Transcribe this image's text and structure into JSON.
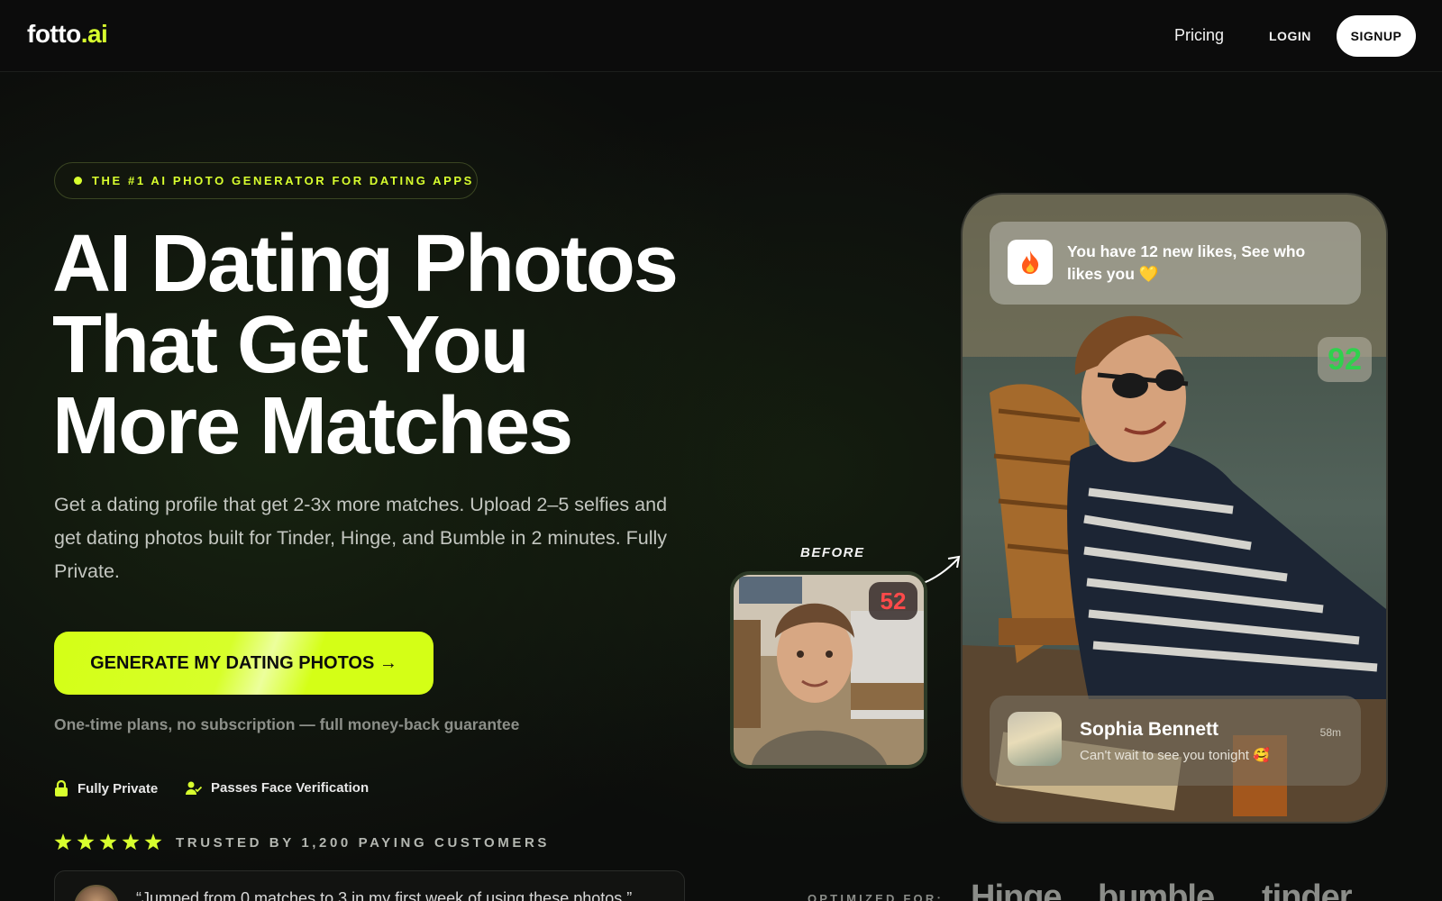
{
  "header": {
    "logo_main": "fotto",
    "logo_tld": ".ai",
    "nav_pricing": "Pricing",
    "nav_login": "LOGIN",
    "nav_signup": "SIGNUP"
  },
  "hero": {
    "badge": "THE #1 AI PHOTO GENERATOR FOR DATING APPS",
    "headline_lines": [
      "AI Dating Photos",
      "That Get You",
      "More Matches"
    ],
    "subtext": "Get a dating profile that get 2-3x more matches. Upload 2–5 selfies and get dating photos built for Tinder, Hinge, and Bumble in 2 minutes. Fully Private.",
    "cta": "GENERATE MY DATING PHOTOS →",
    "guarantee": "One-time plans, no subscription — full money-back guarantee",
    "features": [
      {
        "label": "Fully Private",
        "icon": "lock-icon"
      },
      {
        "label": "Passes Face Verification",
        "icon": "user-check-icon"
      }
    ],
    "rating_stars": 5,
    "trusted": "TRUSTED BY 1,200 PAYING CUSTOMERS",
    "testimonial": "“Jumped from 0 matches to 3 in my first week of using these photos.”"
  },
  "showcase": {
    "before_label": "BEFORE",
    "before_score": "52",
    "after_score": "92",
    "notification": "You have 12 new likes, See who likes you 💛",
    "message": {
      "name": "Sophia Bennett",
      "text": "Can't wait to see you tonight 🥰",
      "time": "58m"
    },
    "optimized_for": "OPTIMIZED FOR:",
    "apps": [
      "Hinge",
      "bumble",
      "tinder"
    ]
  },
  "colors": {
    "accent": "#d8ff2e",
    "score_good": "#2fd14d",
    "score_bad": "#ff4a4a"
  }
}
